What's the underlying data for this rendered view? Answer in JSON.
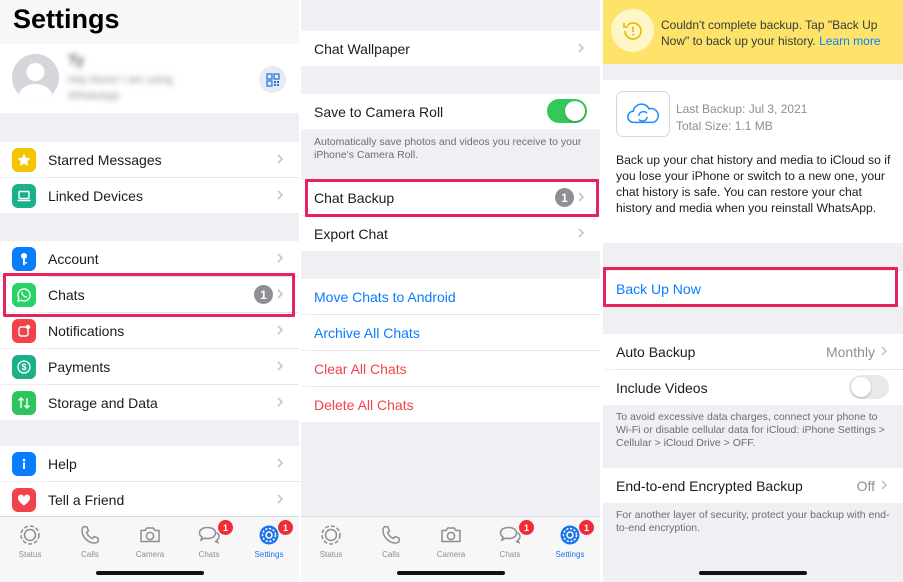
{
  "panel1": {
    "title": "Settings",
    "profile": {
      "name": "Ty",
      "status": "Hey there! I am using WhatsApp."
    },
    "group1": [
      {
        "label": "Starred Messages",
        "icon": "star-icon",
        "color": "#f5c400"
      },
      {
        "label": "Linked Devices",
        "icon": "laptop-icon",
        "color": "#1ab089"
      }
    ],
    "group2": [
      {
        "label": "Account",
        "icon": "key-icon",
        "color": "#0a7cff"
      },
      {
        "label": "Chats",
        "icon": "whatsapp-icon",
        "color": "#25d366",
        "badge": "1"
      },
      {
        "label": "Notifications",
        "icon": "notification-icon",
        "color": "#f2434b"
      },
      {
        "label": "Payments",
        "icon": "dollar-icon",
        "color": "#1ab089"
      },
      {
        "label": "Storage and Data",
        "icon": "storage-arrows-icon",
        "color": "#2dc45c"
      }
    ],
    "group3": [
      {
        "label": "Help",
        "icon": "info-icon",
        "color": "#0a7cff"
      },
      {
        "label": "Tell a Friend",
        "icon": "heart-icon",
        "color": "#f2434b"
      }
    ]
  },
  "panel2": {
    "chat_wallpaper": "Chat Wallpaper",
    "save_to_camera_roll": "Save to Camera Roll",
    "save_to_camera_roll_on": true,
    "save_note": "Automatically save photos and videos you receive to your iPhone's Camera Roll.",
    "chat_backup": "Chat Backup",
    "chat_backup_badge": "1",
    "export_chat": "Export Chat",
    "move_to_android": "Move Chats to Android",
    "archive_all": "Archive All Chats",
    "clear_all": "Clear All Chats",
    "delete_all": "Delete All Chats"
  },
  "panel3": {
    "banner_text": "Couldn't complete backup. Tap \"Back Up Now\" to back up your history.",
    "banner_link": "Learn more",
    "last_backup": "Last Backup: Jul 3, 2021",
    "total_size": "Total Size: 1.1 MB",
    "description": "Back up your chat history and media to iCloud so if you lose your iPhone or switch to a new one, your chat history is safe. You can restore your chat history and media when you reinstall WhatsApp.",
    "back_up_now": "Back Up Now",
    "auto_backup": "Auto Backup",
    "auto_backup_value": "Monthly",
    "include_videos": "Include Videos",
    "include_videos_on": false,
    "data_note": "To avoid excessive data charges, connect your phone to Wi-Fi or disable cellular data for iCloud: iPhone Settings > Cellular > iCloud Drive > OFF.",
    "e2e_backup": "End-to-end Encrypted Backup",
    "e2e_value": "Off",
    "e2e_note": "For another layer of security, protect your backup with end-to-end encryption."
  },
  "tabbar": {
    "tabs": [
      {
        "label": "Status",
        "icon": "status-icon"
      },
      {
        "label": "Calls",
        "icon": "phone-icon"
      },
      {
        "label": "Camera",
        "icon": "camera-icon"
      },
      {
        "label": "Chats",
        "icon": "chat-bubbles-icon",
        "badge": "1"
      },
      {
        "label": "Settings",
        "icon": "gear-icon",
        "badge": "1",
        "active": true
      }
    ]
  },
  "colors": {
    "accent": "#1a73e8",
    "link_blue": "#0a7cff",
    "destructive": "#f2434b",
    "highlight": "#e8225d",
    "toggle_on": "#34c759",
    "banner_bg": "#fde36a",
    "badge_red": "#f02c37"
  }
}
